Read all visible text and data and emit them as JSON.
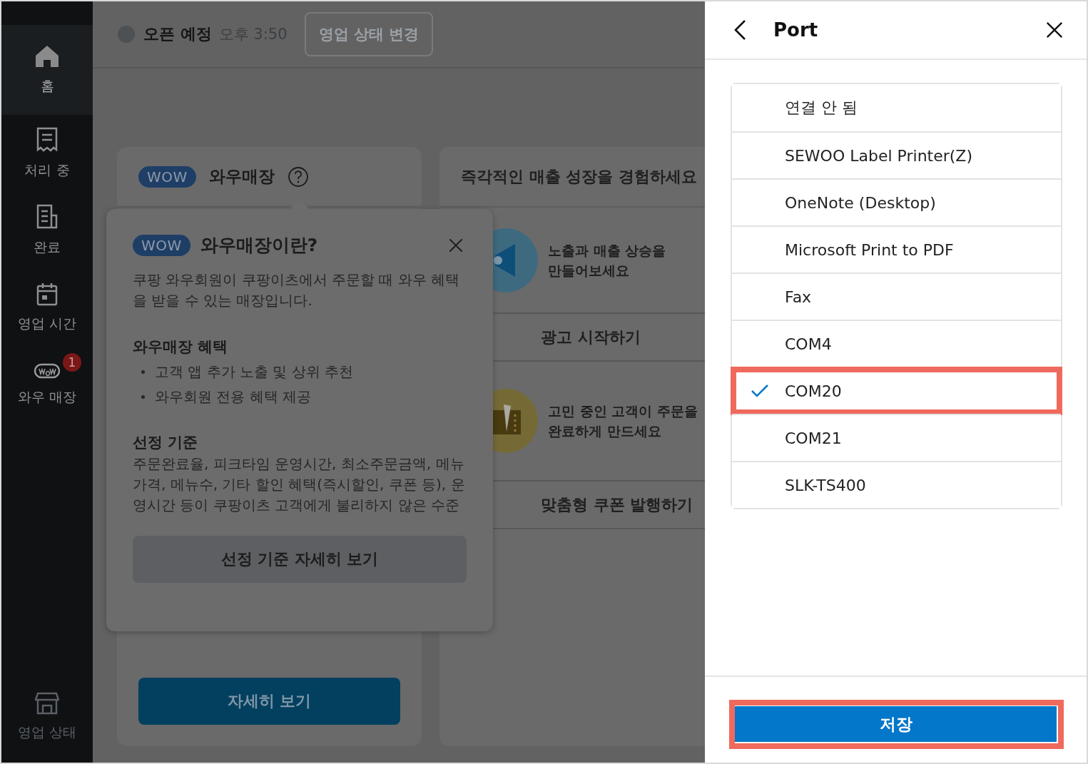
{
  "sidebar": {
    "items": [
      {
        "label": "홈",
        "kind": "home",
        "selected": true,
        "disabled": false
      },
      {
        "label": "처리 중",
        "kind": "receipt",
        "selected": false,
        "disabled": false
      },
      {
        "label": "완료",
        "kind": "done",
        "selected": false,
        "disabled": false
      },
      {
        "label": "영업 시간",
        "kind": "calendar",
        "selected": false,
        "disabled": false
      },
      {
        "label": "와우 매장",
        "kind": "wow",
        "badge": "1",
        "selected": false,
        "disabled": false
      },
      {
        "label": "영업 상태",
        "kind": "store",
        "selected": false,
        "disabled": true
      }
    ]
  },
  "top_bar": {
    "status": "오픈 예정",
    "time": "오후 3:50",
    "button": "영업 상태 변경"
  },
  "wow_card": {
    "badge": "WOW",
    "title": "와우매장",
    "button": "자세히 보기"
  },
  "promo_card": {
    "title": "즉각적인 매출 성장을 경험하세요",
    "sections": [
      {
        "kind": "megaphone",
        "lines": [
          "노출과 매출 상승을",
          "만들어보세요"
        ],
        "button": "광고 시작하기"
      },
      {
        "kind": "film",
        "lines": [
          "고민 중인 고객이 주문을",
          "완료하게 만드세요"
        ],
        "button": "맞춤형 쿠폰 발행하기"
      }
    ]
  },
  "popover": {
    "badge": "WOW",
    "title": "와우매장이란?",
    "intro": "쿠팡 와우회원이 쿠팡이츠에서 주문할 때 와우 혜택을 받을 수 있는 매장입니다.",
    "benefits_title": "와우매장 혜택",
    "benefits": [
      "고객 앱 추가 노출 및 상위 추천",
      "와우회원 전용 혜택 제공"
    ],
    "criteria_title": "선정 기준",
    "criteria": "주문완료율, 피크타임 운영시간, 최소주문금액, 메뉴가격, 메뉴수, 기타 할인 혜택(즉시할인, 쿠폰 등), 운영시간 등이 쿠팡이츠 고객에게 불리하지 않은 수준",
    "button": "선정 기준 자세히 보기"
  },
  "port_panel": {
    "title": "Port",
    "options": [
      {
        "label": "연결 안 됨",
        "selected": false,
        "highlighted": false
      },
      {
        "label": "SEWOO Label Printer(Z)",
        "selected": false,
        "highlighted": false
      },
      {
        "label": "OneNote (Desktop)",
        "selected": false,
        "highlighted": false
      },
      {
        "label": "Microsoft Print to PDF",
        "selected": false,
        "highlighted": false
      },
      {
        "label": "Fax",
        "selected": false,
        "highlighted": false
      },
      {
        "label": "COM4",
        "selected": false,
        "highlighted": false
      },
      {
        "label": "COM20",
        "selected": true,
        "highlighted": true
      },
      {
        "label": "COM21",
        "selected": false,
        "highlighted": false
      },
      {
        "label": "SLK-TS400",
        "selected": false,
        "highlighted": false
      }
    ],
    "save": {
      "label": "저장",
      "highlighted": true
    }
  }
}
